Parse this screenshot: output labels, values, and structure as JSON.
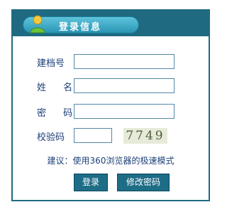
{
  "header": {
    "title": "登录信息",
    "icon": "user-icon"
  },
  "form": {
    "archive_no": {
      "label": "建档号",
      "value": ""
    },
    "name": {
      "label": "姓 名",
      "value": ""
    },
    "password": {
      "label": "密 码",
      "value": ""
    },
    "captcha": {
      "label": "校验码",
      "value": "",
      "image_text": "7749"
    }
  },
  "hint": "建议：使用360浏览器的极速模式",
  "buttons": {
    "login": "登录",
    "change_password": "修改密码"
  },
  "colors": {
    "header_bg": "#1f6a80",
    "tab_gradient_top": "#5ec4dc",
    "label_text": "#1c3e77",
    "button_bg": "#1e6d86"
  }
}
